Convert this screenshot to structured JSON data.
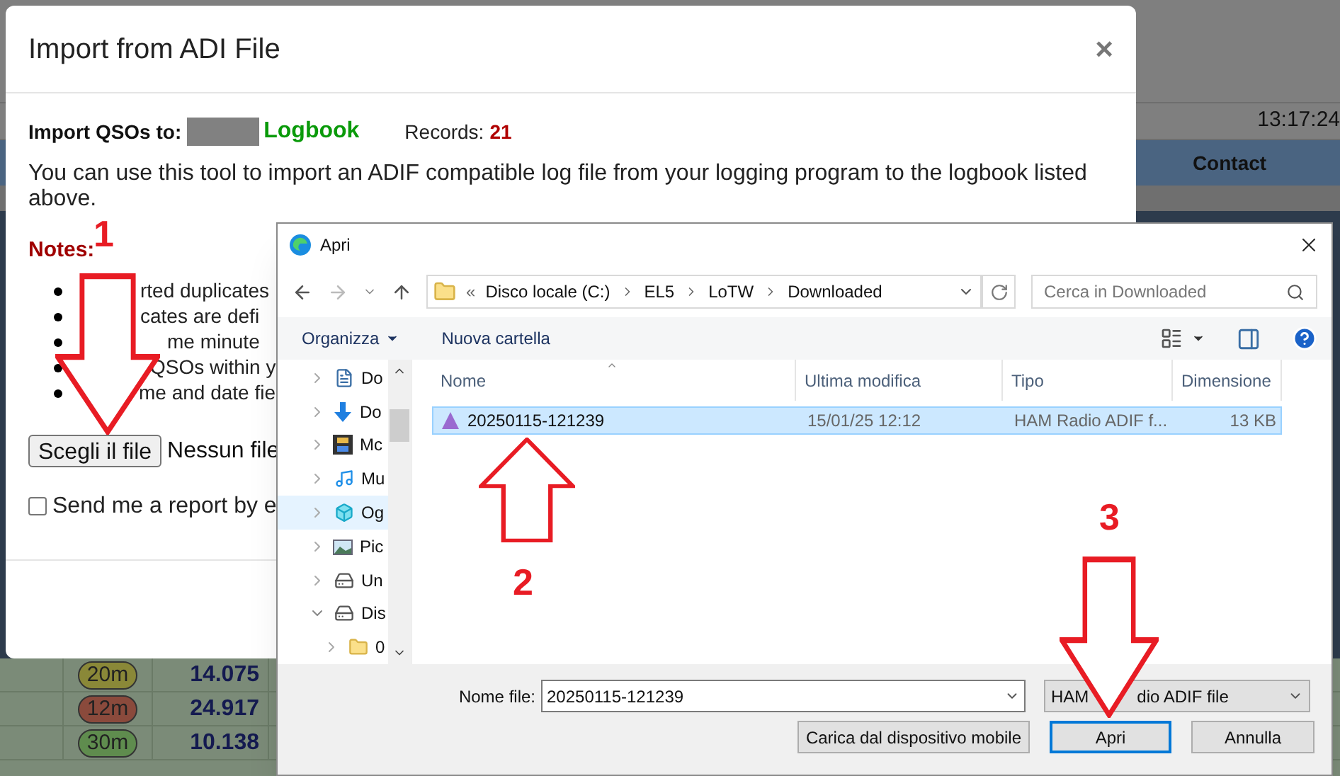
{
  "background_page": {
    "clock": "13:17:24",
    "header": "Contact",
    "rows": [
      {
        "band": "20m",
        "color": "#8a8838",
        "frequency": "14.075"
      },
      {
        "band": "12m",
        "color": "#8a4a3c",
        "frequency": "24.917"
      },
      {
        "band": "30m",
        "color": "#5f8c4e",
        "frequency": "10.138"
      }
    ]
  },
  "import_dialog": {
    "title": "Import from ADI File",
    "close": "×",
    "import_label": "Import QSOs to:",
    "logbook": "Logbook",
    "records_label": "Records:",
    "records": "21",
    "description": "You can use this tool to import an ADIF compatible log file from your logging program to the logbook listed above.",
    "notes_title": "Notes:",
    "notes": [
      "rted duplicates",
      "cates are defi",
      "me minute",
      "QSOs within y",
      "me and date fie"
    ],
    "file_button": "Scegli il file",
    "file_status": "Nessun file",
    "report_checkbox": {
      "label": "Send me a report by e",
      "checked": false
    }
  },
  "file_dialog": {
    "title": "Apri",
    "path_prefix": "«",
    "path": [
      "Disco locale (C:)",
      "EL5",
      "LoTW",
      "Downloaded"
    ],
    "search": {
      "placeholder": "Cerca in Downloaded"
    },
    "toolbar": {
      "organize": "Organizza",
      "new_folder": "Nuova cartella"
    },
    "nav_items": [
      {
        "label": "Do",
        "selected": false,
        "expanded": false
      },
      {
        "label": "Do",
        "selected": false,
        "expanded": false
      },
      {
        "label": "Mc",
        "selected": false,
        "expanded": false
      },
      {
        "label": "Mu",
        "selected": false,
        "expanded": false
      },
      {
        "label": "Og",
        "selected": true,
        "expanded": false
      },
      {
        "label": "Pic",
        "selected": false,
        "expanded": false
      },
      {
        "label": "Un",
        "selected": false,
        "expanded": false
      },
      {
        "label": "Dis",
        "selected": false,
        "expanded": true,
        "children": [
          {
            "label": "0",
            "selected": false,
            "expanded": false
          }
        ]
      }
    ],
    "columns": [
      "Nome",
      "Ultima modifica",
      "Tipo",
      "Dimensione"
    ],
    "files": [
      {
        "name": "20250115-121239",
        "modified": "15/01/25 12:12",
        "type": "HAM Radio ADIF f...",
        "size": "13 KB",
        "selected": true
      }
    ],
    "filename_label": "Nome file:",
    "filename": "20250115-121239",
    "filter_parts": [
      "HAM",
      "dio ADIF file"
    ],
    "buttons": [
      {
        "label": "Carica dal dispositivo mobile",
        "default": false
      },
      {
        "label": "Apri",
        "default": true
      },
      {
        "label": "Annulla",
        "default": false
      }
    ]
  },
  "annotations": [
    {
      "number": "1",
      "kind": "down"
    },
    {
      "number": "2",
      "kind": "up"
    },
    {
      "number": "3",
      "kind": "down"
    }
  ]
}
